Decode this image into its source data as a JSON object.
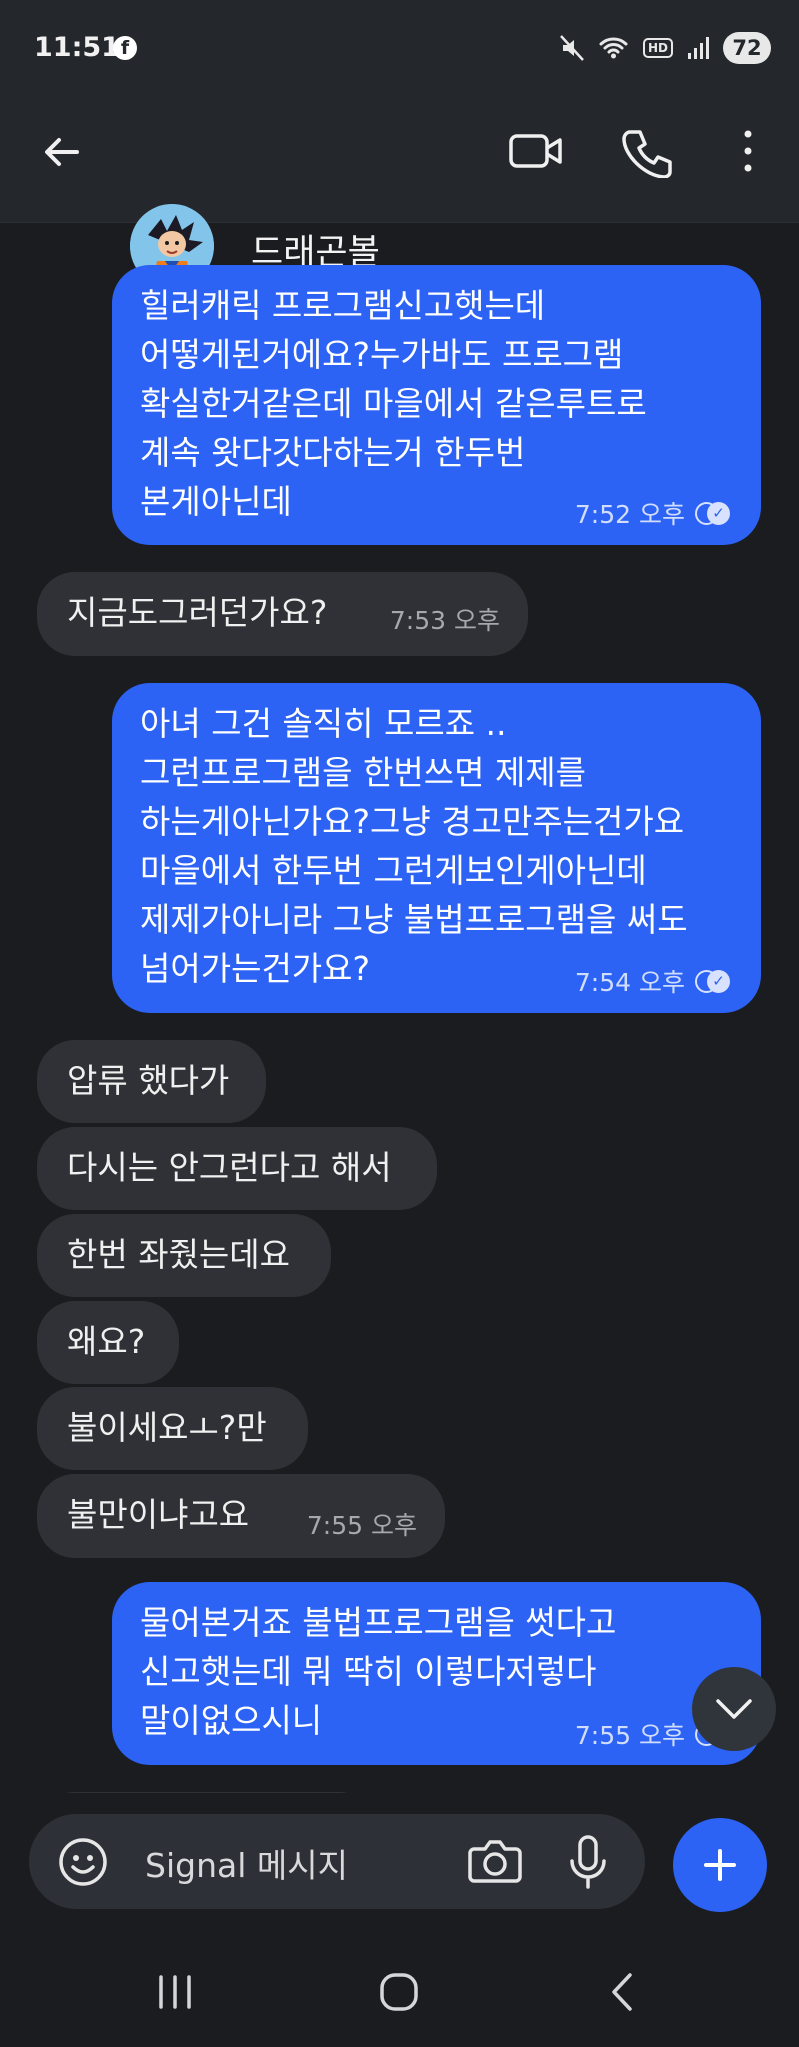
{
  "status_bar": {
    "time": "11:51",
    "facebook_glyph": "f",
    "hd_label": "HD",
    "battery": "72",
    "icons": [
      "facebook-icon",
      "mute-icon",
      "wifi-icon",
      "signal-icon",
      "battery-icon"
    ]
  },
  "header": {
    "title": "드래곤볼",
    "icons": [
      "back-arrow-icon",
      "video-call-icon",
      "phone-call-icon",
      "more-vert-icon"
    ]
  },
  "messages": [
    {
      "direction": "outgoing",
      "text": "힐러캐릭 프로그램신고햇는데\n어떻게된거에요?누가바도 프로그램\n확실한거같은데 마을에서 같은루트로\n계속 왓다갓다하는거 한두번\n본게아닌데",
      "time": "7:52 오후",
      "delivered": true
    },
    {
      "direction": "incoming",
      "text": "지금도그러던가요?",
      "time": "7:53 오후"
    },
    {
      "direction": "outgoing",
      "text": "아녀 그건 솔직히 모르죠 ..\n그런프로그램을 한번쓰면 제제를\n하는게아닌가요?그냥 경고만주는건가요\n마을에서 한두번 그런게보인게아닌데\n제제가아니라 그냥 불법프로그램을 써도\n넘어가는건가요?",
      "time": "7:54 오후",
      "delivered": true
    },
    {
      "direction": "incoming",
      "text": "압류 했다가"
    },
    {
      "direction": "incoming",
      "text": "다시는 안그런다고 해서"
    },
    {
      "direction": "incoming",
      "text": "한번 좌줬는데요"
    },
    {
      "direction": "incoming",
      "text": "왜요?"
    },
    {
      "direction": "incoming",
      "text": "불이세요ㅗ?만"
    },
    {
      "direction": "incoming",
      "text": "불만이냐고요",
      "time": "7:55 오후"
    },
    {
      "direction": "outgoing",
      "text": "물어본거죠 불법프로그램을 썻다고\n신고햇는데 뭐 딱히 이렇다저렇다\n말이없으시니",
      "time": "7:55 오후",
      "delivered": true
    }
  ],
  "composer": {
    "placeholder": "Signal 메시지",
    "icons": [
      "emoji-icon",
      "camera-icon",
      "microphone-icon",
      "plus-icon"
    ]
  },
  "scroll_button": {
    "icon": "chevron-down-icon"
  },
  "navigation": {
    "icons": [
      "recent-apps-icon",
      "home-icon",
      "back-icon"
    ]
  },
  "colors": {
    "background": "#1b1c1f",
    "header": "#24272c",
    "outgoing_bubble": "#2c63f5",
    "incoming_bubble": "#303136",
    "accent": "#2c63f5"
  }
}
